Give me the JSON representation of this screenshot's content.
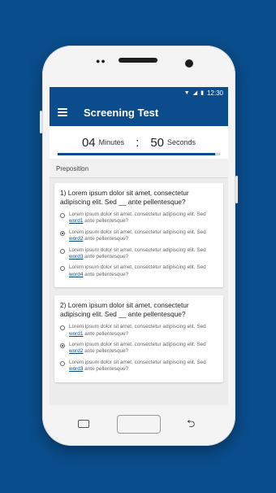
{
  "status_bar": {
    "time": "12:30"
  },
  "app_bar": {
    "title": "Screening Test"
  },
  "timer": {
    "minutes": "04",
    "minutes_label": "Minutes",
    "separator": ":",
    "seconds": "50",
    "seconds_label": "Seconds",
    "progress": 0.97
  },
  "section": {
    "label": "Preposition"
  },
  "questions": [
    {
      "text": "1) Lorem ipsum dolor sit amet, consectetur adipiscing elit. Sed __ ante pellentesque?",
      "options": [
        {
          "pre": "Lorem ipsum dolor sit amet, consectetur adipiscing elit. Sed ",
          "word": "word1",
          "post": " ante pellentesque?",
          "checked": false
        },
        {
          "pre": "Lorem ipsum dolor sit amet, consectetur adipiscing elit. Sed ",
          "word": "word2",
          "post": " ante pellentesque?",
          "checked": true
        },
        {
          "pre": "Lorem ipsum dolor sit amet, consectetur adipiscing elit. Sed ",
          "word": "word3",
          "post": " ante pellentesque?",
          "checked": false
        },
        {
          "pre": "Lorem ipsum dolor sit amet, consectetur adipiscing elit. Sed ",
          "word": "word4",
          "post": " ante pellentesque?",
          "checked": false
        }
      ]
    },
    {
      "text": "2) Lorem ipsum dolor sit amet, consectetur adipiscing elit. Sed __ ante pellentesque?",
      "options": [
        {
          "pre": "Lorem ipsum dolor sit amet, consectetur adipiscing elit. Sed ",
          "word": "word1",
          "post": " ante pellentesque?",
          "checked": false
        },
        {
          "pre": "Lorem ipsum dolor sit amet, consectetur adipiscing elit. Sed ",
          "word": "word2",
          "post": " ante pellentesque?",
          "checked": true
        },
        {
          "pre": "Lorem ipsum dolor sit amet, consectetur adipiscing elit. Sed ",
          "word": "word3",
          "post": " ante pellentesque?",
          "checked": false
        }
      ]
    }
  ],
  "colors": {
    "primary": "#0b4d8c",
    "background": "#0a4d8c"
  }
}
